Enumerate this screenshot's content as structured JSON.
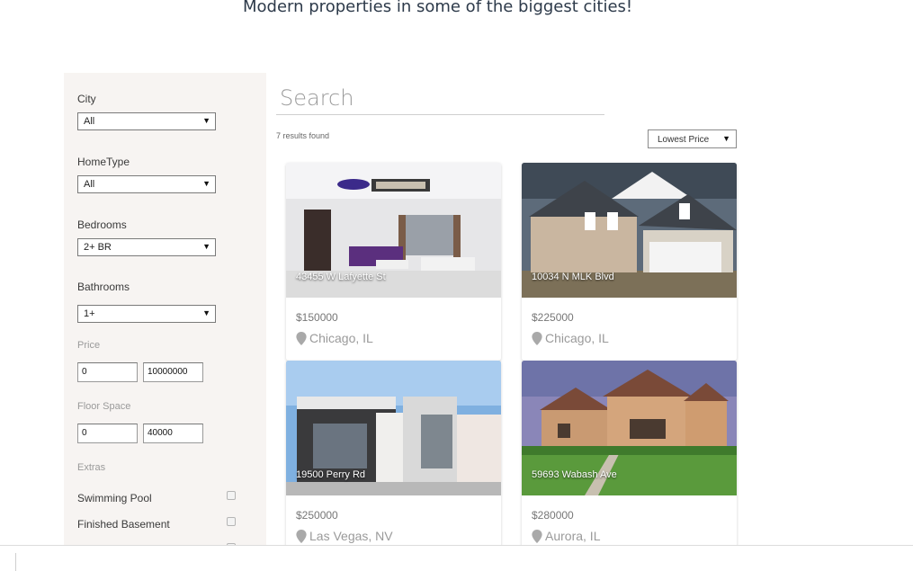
{
  "header": {
    "tagline": "Modern properties in some of the biggest cities!"
  },
  "filters": {
    "city": {
      "label": "City",
      "value": "All"
    },
    "hometype": {
      "label": "HomeType",
      "value": "All"
    },
    "bedrooms": {
      "label": "Bedrooms",
      "value": "2+ BR"
    },
    "bathrooms": {
      "label": "Bathrooms",
      "value": "1+"
    },
    "price": {
      "label": "Price",
      "min": "0",
      "max": "10000000"
    },
    "floor_space": {
      "label": "Floor Space",
      "min": "0",
      "max": "40000"
    },
    "extras": {
      "label": "Extras",
      "items": [
        {
          "label": "Swimming Pool",
          "checked": false
        },
        {
          "label": "Finished Basement",
          "checked": false
        }
      ]
    }
  },
  "search": {
    "placeholder": "Search"
  },
  "results": {
    "count_text": "7 results found",
    "sort_value": "Lowest Price"
  },
  "listings": [
    {
      "address": "43455 W Lafyette St",
      "price": "$150000",
      "location": "Chicago, IL"
    },
    {
      "address": "10034 N MLK Blvd",
      "price": "$225000",
      "location": "Chicago, IL"
    },
    {
      "address": "19500 Perry Rd",
      "price": "$250000",
      "location": "Las Vegas, NV"
    },
    {
      "address": "59693 Wabash Ave",
      "price": "$280000",
      "location": "Aurora, IL"
    }
  ],
  "colors": {
    "sidebar_bg": "#f7f4f2",
    "pin": "#a9a9a9"
  }
}
